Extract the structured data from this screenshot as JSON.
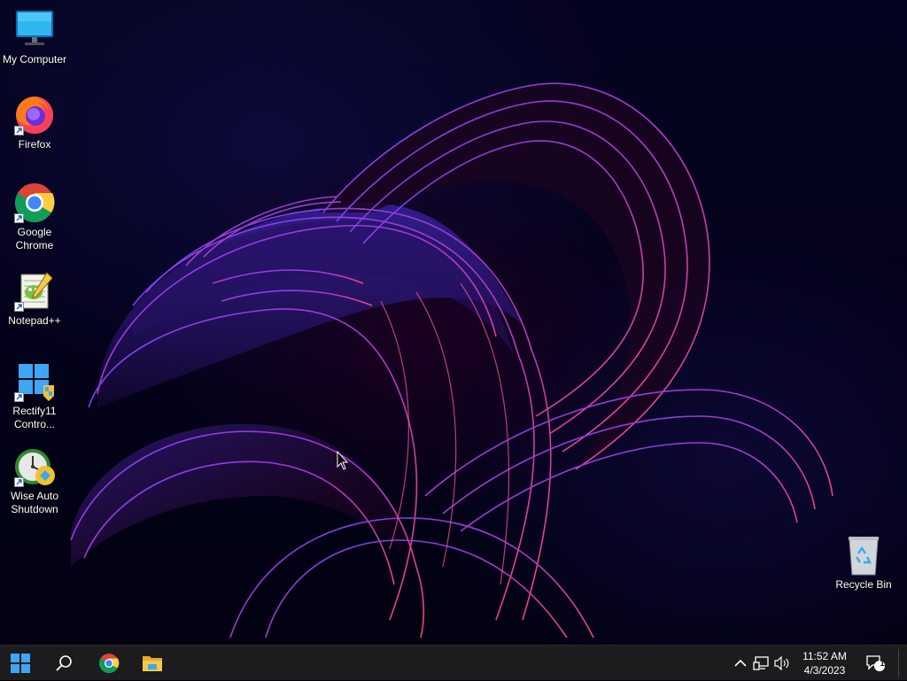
{
  "desktop": {
    "icons": [
      {
        "label": "My Computer",
        "icon": "monitor-icon"
      },
      {
        "label": "Firefox",
        "icon": "firefox-icon"
      },
      {
        "label": "Google Chrome",
        "icon": "chrome-icon"
      },
      {
        "label": "Notepad++",
        "icon": "notepad-plus-plus-icon"
      },
      {
        "label": "Rectify11 Contro...",
        "icon": "rectify11-icon"
      },
      {
        "label": "Wise Auto Shutdown",
        "icon": "wise-auto-shutdown-icon"
      }
    ],
    "recycle_bin": {
      "label": "Recycle Bin",
      "icon": "recycle-bin-icon"
    }
  },
  "taskbar": {
    "pinned": [
      "windows-start-icon",
      "search-icon",
      "chrome-icon",
      "file-explorer-icon"
    ],
    "tray": [
      "chevron-up-icon",
      "network-icon",
      "volume-icon"
    ],
    "time": "11:52 AM",
    "date": "4/3/2023",
    "notification_count": "1"
  },
  "colors": {
    "taskbar_bg": "#1c1c1e",
    "windows_blue": "#3ea6f2",
    "bloom_magenta": "#d63aa8",
    "bloom_purple": "#6b33d6"
  }
}
